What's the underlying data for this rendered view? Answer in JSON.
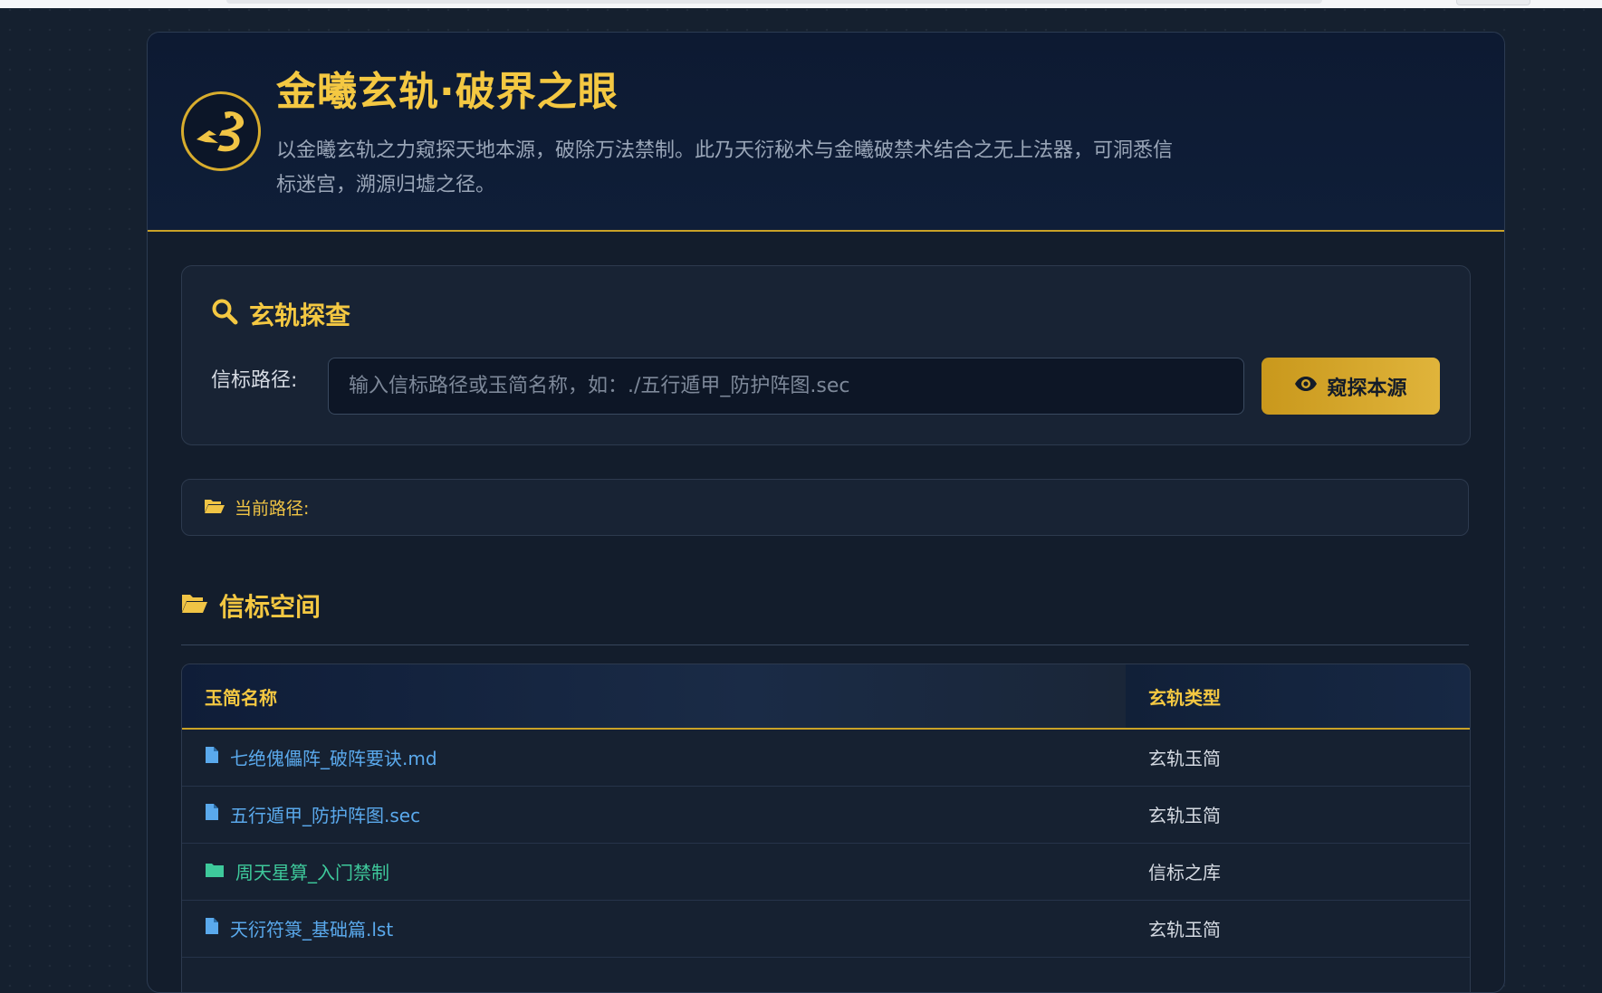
{
  "header": {
    "title": "金曦玄轨·破界之眼",
    "description": "以金曦玄轨之力窥探天地本源，破除万法禁制。此乃天衍秘术与金曦破禁术结合之无上法器，可洞悉信标迷宫，溯源归墟之径。"
  },
  "search_panel": {
    "title": "玄轨探查",
    "field_label": "信标路径:",
    "input_value": "",
    "input_placeholder": "输入信标路径或玉简名称，如：./五行遁甲_防护阵图.sec",
    "button_label": "窥探本源"
  },
  "current_path": {
    "label": "当前路径:",
    "value": ""
  },
  "listing": {
    "title": "信标空间",
    "columns": [
      "玉简名称",
      "玄轨类型"
    ],
    "rows": [
      {
        "name": "七绝傀儡阵_破阵要诀.md",
        "type": "玄轨玉简",
        "kind": "file"
      },
      {
        "name": "五行遁甲_防护阵图.sec",
        "type": "玄轨玉简",
        "kind": "file"
      },
      {
        "name": "周天星算_入门禁制",
        "type": "信标之库",
        "kind": "folder"
      },
      {
        "name": "天衍符箓_基础篇.lst",
        "type": "玄轨玉简",
        "kind": "file"
      }
    ]
  },
  "icons": {
    "logo": "dragon-emblem-icon",
    "search": "search-icon",
    "probe": "eye-icon",
    "breadcrumb": "folder-open-icon",
    "section": "folder-open-icon",
    "file": "file-icon",
    "folder": "folder-icon"
  },
  "colors": {
    "accent_gold": "#f4c842",
    "button_gold": "#d4a62c",
    "link_blue": "#5aa9ec",
    "folder_green": "#3ec99b",
    "background": "#15202f"
  }
}
